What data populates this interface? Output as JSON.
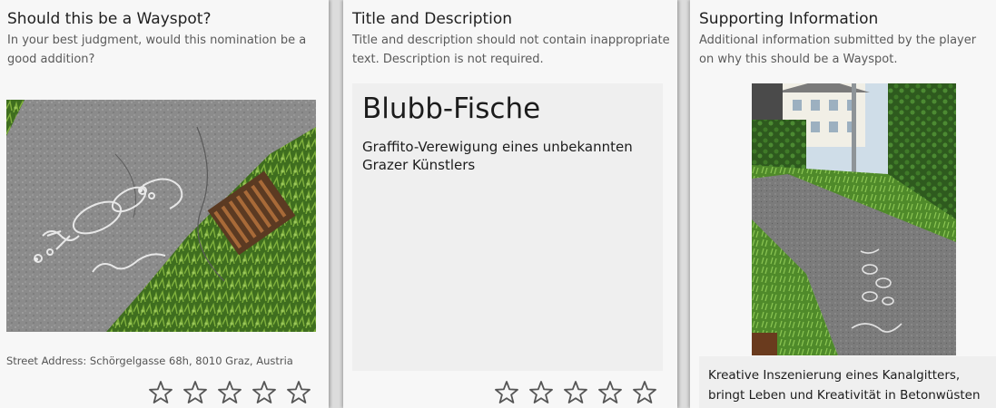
{
  "cards": {
    "eligibility": {
      "title": "Should this be a Wayspot?",
      "subtitle": "In your best judgment, would this nomination be a good addition?",
      "photo_alt": "Chalk graffiti of fish on asphalt next to a drain grate",
      "address": "Street Address: Schörgelgasse 68h, 8010 Graz, Austria",
      "rating": {
        "max": 5,
        "value": 0
      }
    },
    "title_description": {
      "title": "Title and Description",
      "subtitle": "Title and description should not contain inappropriate text. Description is not required.",
      "nomination_title": "Blubb-Fische",
      "nomination_description": "Graffito-Verewigung eines unbekannten Grazer Künstlers",
      "rating": {
        "max": 5,
        "value": 0
      }
    },
    "supporting": {
      "title": "Supporting Information",
      "subtitle": "Additional information submitted by the player on why this should be a Wayspot.",
      "photo_alt": "Footpath with chalk graffiti near a house",
      "info_text": "Kreative Inszenierung eines Kanalgitters, bringt Leben und Kreativität in Betonwüsten"
    }
  },
  "icons": {
    "star": "star-outline-icon"
  },
  "colors": {
    "card_background": "#f7f7f7",
    "page_background": "#dcdcdc",
    "text_dark": "#1f1f1f",
    "text_muted": "#5a5a5a",
    "star_outline": "#555555",
    "text_box": "#efefef"
  }
}
